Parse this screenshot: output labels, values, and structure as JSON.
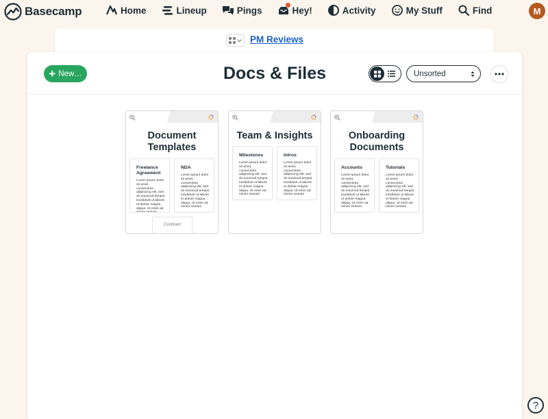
{
  "brand": {
    "name": "Basecamp",
    "icon": "basecamp-logo"
  },
  "nav": [
    {
      "label": "Home",
      "icon": "home-icon"
    },
    {
      "label": "Lineup",
      "icon": "lineup-icon"
    },
    {
      "label": "Pings",
      "icon": "pings-icon"
    },
    {
      "label": "Hey!",
      "icon": "hey-icon"
    },
    {
      "label": "Activity",
      "icon": "activity-icon"
    },
    {
      "label": "My Stuff",
      "icon": "smiley-icon"
    },
    {
      "label": "Find",
      "icon": "search-icon"
    }
  ],
  "avatar": {
    "initial": "M",
    "color": "#b55a1f"
  },
  "breadcrumb": {
    "project": "PM Reviews"
  },
  "toolbar": {
    "new_label": "New…",
    "sort_value": "Unsorted"
  },
  "page": {
    "title": "Docs & Files"
  },
  "folders": [
    {
      "name": "Document Templates",
      "docs": [
        {
          "title": "Freelance Agreement",
          "body": "Lorem ipsum dolor sit amet, consectetur adipiscing elit, sed do eiusmod tempor incididunt ut labore et dolore magna aliqua. Ut enim ad minim veniam"
        },
        {
          "title": "NDA",
          "body": "Lorem ipsum dolor sit amet, consectetur adipiscing elit, sed do eiusmod tempor incididunt ut labore et dolore magna aliqua. Ut enim ad minim veniam"
        }
      ],
      "extra": "Contract"
    },
    {
      "name": "Team & Insights",
      "docs": [
        {
          "title": "Milestones",
          "body": "Lorem ipsum dolor sit amet, consectetur adipiscing elit, sed do eiusmod tempor incididunt ut labore et dolore magna aliqua. Ut enim ad minim veniam"
        },
        {
          "title": "Intros",
          "body": "Lorem ipsum dolor sit amet, consectetur adipiscing elit, sed do eiusmod tempor incididunt ut labore et dolore magna aliqua. Ut enim ad minim veniam"
        }
      ]
    },
    {
      "name": "Onboarding Documents",
      "docs": [
        {
          "title": "Accounts",
          "body": "Lorem ipsum dolor sit amet, consectetur adipiscing elit, sed do eiusmod tempor incididunt ut labore et dolore magna aliqua. Ut enim ad minim veniam"
        },
        {
          "title": "Tutorials",
          "body": "Lorem ipsum dolor sit amet, consectetur adipiscing elit, sed do eiusmod tempor incididunt ut labore et dolore magna aliqua. Ut enim ad minim veniam"
        }
      ]
    }
  ],
  "help": {
    "label": "?"
  },
  "colors": {
    "accent_green": "#28a55f",
    "link_blue": "#1a62c7",
    "text_dark": "#1d2d35",
    "background": "#fbf5ee",
    "notification": "#e8582c"
  }
}
